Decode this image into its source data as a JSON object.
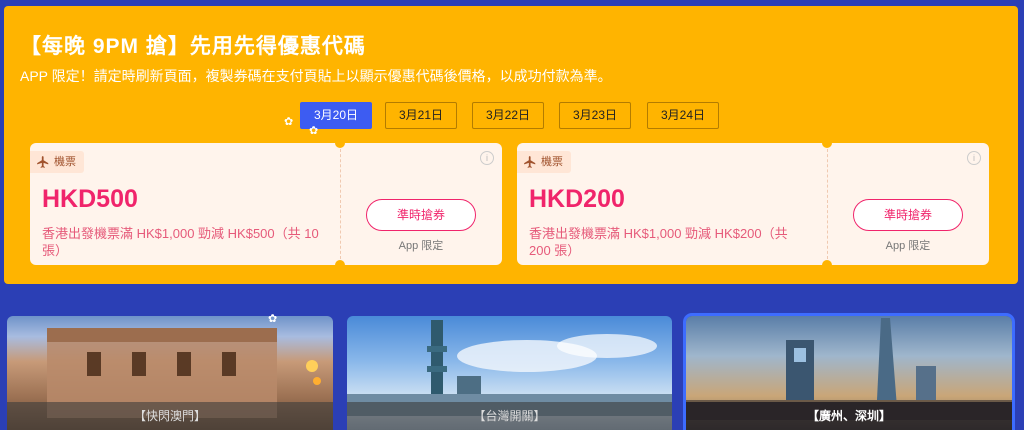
{
  "promo": {
    "title": "【每晚 9PM 搶】先用先得優惠代碼",
    "subtitle": "APP 限定！請定時刷新頁面，複製券碼在支付頁貼上以顯示優惠代碼後價格，以成功付款為準。",
    "dates": [
      {
        "label": "3月20日",
        "active": true
      },
      {
        "label": "3月21日",
        "active": false
      },
      {
        "label": "3月22日",
        "active": false
      },
      {
        "label": "3月23日",
        "active": false
      },
      {
        "label": "3月24日",
        "active": false
      }
    ],
    "coupons": [
      {
        "tag": "機票",
        "amount": "HKD500",
        "desc": "香港出發機票滿 HK$1,000 勁減 HK$500（共 10 張）",
        "button": "準時搶券",
        "note": "App 限定",
        "info": "i"
      },
      {
        "tag": "機票",
        "amount": "HKD200",
        "desc": "香港出發機票滿 HK$1,000 勁減 HK$200（共 200 張）",
        "button": "準時搶券",
        "note": "App 限定",
        "info": "i"
      }
    ]
  },
  "destinations": [
    {
      "label": "【快閃澳門】",
      "selected": false
    },
    {
      "label": "【台灣開關】",
      "selected": false
    },
    {
      "label": "【廣州、深圳】",
      "selected": true
    }
  ],
  "colors": {
    "accent": "#f0246b",
    "promo_bg": "#ffb400",
    "page_bg": "#2b3fb5",
    "active_tab": "#3d5cf2"
  },
  "icons": {
    "tag_icon": "airplane-icon",
    "info_icon": "info-icon"
  }
}
